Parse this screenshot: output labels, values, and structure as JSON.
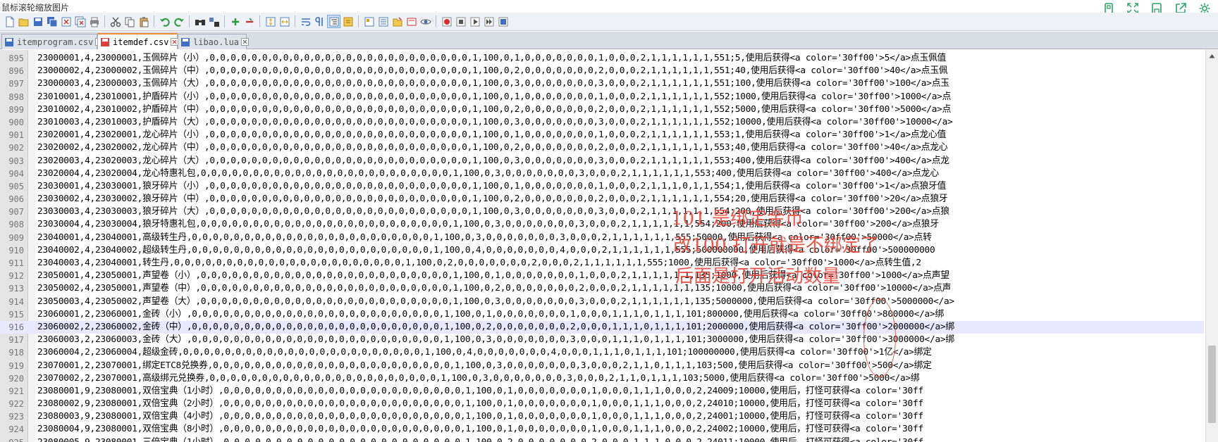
{
  "window": {
    "title": "鼠标滚轮缩放图片"
  },
  "tabs": [
    {
      "label": "itemprogram.csv",
      "active": false,
      "icon": "file-icon-blue"
    },
    {
      "label": "itemdef.csv",
      "active": true,
      "icon": "file-icon-red"
    },
    {
      "label": "libao.lua",
      "active": false,
      "icon": "file-icon-blue"
    }
  ],
  "editor": {
    "current_line": 916,
    "lines": [
      {
        "n": "895",
        "text": "23000001,4,23000001,玉佩碎片（小）,0,0,0,0,0,0,0,0,0,0,0,0,0,0,0,0,0,0,0,0,0,0,0,0,0,1,100,0,1,0,0,0,0,0,0,0,1,0,0,0,2,1,1,1,1,1,1,551;5,使用后获得<a color='30ff00'>5</a>点玉佩值"
      },
      {
        "n": "896",
        "text": "23000002,4,23000002,玉佩碎片（中）,0,0,0,0,0,0,0,0,0,0,0,0,0,0,0,0,0,0,0,0,0,0,0,0,0,1,100,0,2,0,0,0,0,0,0,0,2,0,0,0,2,1,1,1,1,1,1,551;40,使用后获得<a color='30ff00'>40</a>点玉佩"
      },
      {
        "n": "897",
        "text": "23000003,4,23000003,玉佩碎片（大）,0,0,0,0,0,0,0,0,0,0,0,0,0,0,0,0,0,0,0,0,0,0,0,0,0,1,100,0,3,0,0,0,0,0,0,0,3,0,0,0,2,1,1,1,1,1,1,551;100,使用后获得<a color='30ff00'>100</a>点玉"
      },
      {
        "n": "898",
        "text": "23010001,4,23010001,护盾碎片（小）,0,0,0,0,0,0,0,0,0,0,0,0,0,0,0,0,0,0,0,0,0,0,0,0,0,1,100,0,1,0,0,0,0,0,0,0,1,0,0,0,2,1,1,1,1,1,1,552;1000,使用后获得<a color='30ff00'>1000</a>点"
      },
      {
        "n": "899",
        "text": "23010002,4,23010002,护盾碎片（中）,0,0,0,0,0,0,0,0,0,0,0,0,0,0,0,0,0,0,0,0,0,0,0,0,0,1,100,0,2,0,0,0,0,0,0,0,2,0,0,0,2,1,1,1,1,1,1,552;5000,使用后获得<a color='30ff00'>5000</a>点"
      },
      {
        "n": "900",
        "text": "23010003,4,23010003,护盾碎片（大）,0,0,0,0,0,0,0,0,0,0,0,0,0,0,0,0,0,0,0,0,0,0,0,0,0,1,100,0,3,0,0,0,0,0,0,0,3,0,0,0,2,1,1,1,1,1,1,552;10000,使用后获得<a color='30ff00'>10000</a>"
      },
      {
        "n": "901",
        "text": "23020001,4,23020001,龙心碎片（小）,0,0,0,0,0,0,0,0,0,0,0,0,0,0,0,0,0,0,0,0,0,0,0,0,0,1,100,0,1,0,0,0,0,0,0,0,1,0,0,0,2,1,1,1,1,1,1,553;1,使用后获得<a color='30ff00'>1</a>点龙心值"
      },
      {
        "n": "902",
        "text": "23020002,4,23020002,龙心碎片（中）,0,0,0,0,0,0,0,0,0,0,0,0,0,0,0,0,0,0,0,0,0,0,0,0,0,1,100,0,2,0,0,0,0,0,0,0,2,0,0,0,2,1,1,1,1,1,1,553;40,使用后获得<a color='30ff00'>40</a>点龙心"
      },
      {
        "n": "903",
        "text": "23020003,4,23020003,龙心碎片（大）,0,0,0,0,0,0,0,0,0,0,0,0,0,0,0,0,0,0,0,0,0,0,0,0,0,1,100,0,3,0,0,0,0,0,0,0,3,0,0,0,2,1,1,1,1,1,1,553;400,使用后获得<a color='30ff00'>400</a>点龙"
      },
      {
        "n": "904",
        "text": "23020004,4,23020004,龙心特惠礼包,0,0,0,0,0,0,0,0,0,0,0,0,0,0,0,0,0,0,0,0,0,0,0,0,1,100,0,3,0,0,0,0,0,0,0,3,0,0,0,2,1,1,1,1,1,1,553;400,使用后获得<a color='30ff00'>400</a>点龙心"
      },
      {
        "n": "905",
        "text": "23030001,4,23030001,狼牙碎片（小）,0,0,0,0,0,0,0,0,0,0,0,0,0,0,0,0,0,0,0,0,0,0,0,0,0,1,100,0,1,0,0,0,0,0,0,0,1,0,0,0,2,1,1,1,0,1,1,554;1,使用后获得<a color='30ff00'>1</a>点狼牙值"
      },
      {
        "n": "906",
        "text": "23030002,4,23030002,狼牙碎片（中）,0,0,0,0,0,0,0,0,0,0,0,0,0,0,0,0,0,0,0,0,0,0,0,0,0,1,100,0,2,0,0,0,0,0,0,0,2,0,0,0,2,1,1,1,1,1,1,554;20,使用后获得<a color='30ff00'>20</a>点狼牙"
      },
      {
        "n": "907",
        "text": "23030003,4,23030003,狼牙碎片（大）,0,0,0,0,0,0,0,0,0,0,0,0,0,0,0,0,0,0,0,0,0,0,0,0,0,1,100,0,3,0,0,0,0,0,0,0,3,0,0,0,2,1,1,1,1,1,1,554;200,使用后获得<a color='30ff00'>200</a>点狼"
      },
      {
        "n": "908",
        "text": "23030004,4,23030004,狼牙特惠礼包,0,0,0,0,0,0,0,0,0,0,0,0,0,0,0,0,0,0,0,0,0,0,0,0,1,100,0,3,0,0,0,0,0,0,0,3,0,0,0,2,1,1,1,1,1,1,554;200,使用后获得<a color='30ff00'>200</a>点狼牙"
      },
      {
        "n": "909",
        "text": "23040001,4,23040001,高级转生丹,0,0,0,0,0,0,0,0,0,0,0,0,0,0,0,0,0,0,0,0,0,0,0,1,100,0,3,0,0,0,0,0,0,0,3,0,0,0,2,1,1,1,1,1,1,555;50000,使用后获得<a color='30ff00'>50000</a>点转"
      },
      {
        "n": "910",
        "text": "23040002,4,23040002,超级转生丹,0,0,0,0,0,0,0,0,0,0,0,0,0,0,0,0,0,0,0,0,0,0,0,1,100,0,4,0,0,0,0,0,0,0,4,0,0,0,2,1,1,1,1,1,1,555;500000000,使用后获得<a color='30ff00'>500000000"
      },
      {
        "n": "911",
        "text": "23040003,4,23040001,转生丹,0,0,0,0,0,0,0,0,0,0,0,0,0,0,0,0,0,0,0,0,0,0,1,100,0,2,0,0,0,0,0,0,0,2,0,0,0,2,1,1,1,1,1,1,555;1000,使用后获得<a color='30ff00'>1000</a>点转生值,2"
      },
      {
        "n": "912",
        "text": "23050001,4,23050001,声望卷（小）,0,0,0,0,0,0,0,0,0,0,0,0,0,0,0,0,0,0,0,0,0,0,0,0,1,100,0,1,0,0,0,0,0,0,0,1,0,0,0,2,1,1,1,1,1,1,135;1000,使用后获得<a color='30ff00'>1000</a>点声望"
      },
      {
        "n": "913",
        "text": "23050002,4,23050001,声望卷（中）,0,0,0,0,0,0,0,0,0,0,0,0,0,0,0,0,0,0,0,0,0,0,0,0,1,100,0,2,0,0,0,0,0,0,0,2,0,0,0,2,1,1,1,1,1,1,135;10000,使用后获得<a color='30ff00'>10000</a>点声"
      },
      {
        "n": "914",
        "text": "23050003,4,23050002,声望卷（大）,0,0,0,0,0,0,0,0,0,0,0,0,0,0,0,0,0,0,0,0,0,0,0,0,1,100,0,3,0,0,0,0,0,0,0,3,0,0,0,2,1,1,1,1,1,1,135;5000000,使用后获得<a color='30ff00'>5000000</a>"
      },
      {
        "n": "915",
        "text": "23060001,2,23060001,金砖（小）,0,0,0,0,0,0,0,0,0,0,0,0,0,0,0,0,0,0,0,0,0,0,0,0,1,100,0,1,0,0,0,0,0,0,0,1,0,0,0,1,1,1,0,1,1,1,101;800000,使用后获得<a color='30ff00'>800000</a>绑"
      },
      {
        "n": "916",
        "text": "23060002,2,23060002,金砖（中）,0,0,0,0,0,0,0,0,0,0,0,0,0,0,0,0,0,0,0,0,0,0,0,0,1,100,0,2,0,0,0,0,0,0,0,2,0,0,0,1,1,1,0,1,1,1,101;2000000,使用后获得<a color='30ff00'>2000000</a>绑"
      },
      {
        "n": "917",
        "text": "23060003,2,23060003,金砖（大）,0,0,0,0,0,0,0,0,0,0,0,0,0,0,0,0,0,0,0,0,0,0,0,0,1,100,0,3,0,0,0,0,0,0,0,3,0,0,0,1,1,1,0,1,1,1,101;3000000,使用后获得<a color='30ff00'>3000000</a>绑"
      },
      {
        "n": "918",
        "text": "23060004,2,23060004,超级金砖,0,0,0,0,0,0,0,0,0,0,0,0,0,0,0,0,0,0,0,0,0,0,0,1,100,0,4,0,0,0,0,0,0,0,4,0,0,0,1,1,1,0,1,1,1,101;100000000,使用后获得<a color='30ff00'>1亿</a>绑定"
      },
      {
        "n": "919",
        "text": "23070001,2,23070001,绑定ETC8兑换券,0,0,0,0,0,0,0,0,0,0,0,0,0,0,0,0,0,0,0,0,0,0,0,1,100,0,3,0,0,0,0,0,0,0,3,0,0,0,2,1,1,0,1,1,1,103;500,使用后获得<a color='30ff00'>500</a>绑定"
      },
      {
        "n": "920",
        "text": "23070002,2,23070001,高级绑元兑换券,0,0,0,0,0,0,0,0,0,0,0,0,0,0,0,0,0,0,0,0,0,0,1,100,0,3,0,0,0,0,0,0,0,3,0,0,0,2,1,1,0,1,1,1,103;5000,使用后获得<a color='30ff00'>5000</a>绑"
      },
      {
        "n": "921",
        "text": "23080001,9,23080001,双倍宝典（1小时）,0,0,0,0,0,0,0,0,0,0,0,0,0,0,0,0,0,0,0,0,0,0,0,1,100,0,1,0,0,0,0,0,0,0,1,0,0,0,1,1,1,0,0,0,2,24009;10000,使用后，打怪可获得<a color='30ff"
      },
      {
        "n": "922",
        "text": "23080002,9,23080001,双倍宝典（2小时）,0,0,0,0,0,0,0,0,0,0,0,0,0,0,0,0,0,0,0,0,0,0,0,1,100,0,1,0,0,0,0,0,0,0,1,0,0,0,1,1,1,0,0,0,2,24010;10000,使用后，打怪可获得<a color='30ff"
      },
      {
        "n": "923",
        "text": "23080003,9,23080001,双倍宝典（4小时）,0,0,0,0,0,0,0,0,0,0,0,0,0,0,0,0,0,0,0,0,0,0,0,1,100,0,1,0,0,0,0,0,0,0,1,0,0,0,1,1,1,0,0,0,2,24001;10000,使用后，打怪可获得<a color='30ff"
      },
      {
        "n": "924",
        "text": "23080004,9,23080001,双倍宝典（8小时）,0,0,0,0,0,0,0,0,0,0,0,0,0,0,0,0,0,0,0,0,0,0,0,1,100,0,1,0,0,0,0,0,0,0,1,0,0,0,1,1,1,0,0,0,2,24002;10000,使用后，打怪可获得<a color='30ff"
      },
      {
        "n": "925",
        "text": "23080005,9,23080001,三倍宝典（1小时）,0,0,0,0,0,0,0,0,0,0,0,0,0,0,0,0,0,0,0,0,0,0,0,1,100,0,2,0,0,0,0,0,0,0,2,0,0,0,1,1,1,0,0,0,2,24011;10000,使用后，打怪可获得<a color='30ff"
      }
    ]
  },
  "annotation": {
    "lines": [
      "101 是绑定金币",
      "改100 打开就是不绑定了",
      "后面是打开活动数量"
    ],
    "color": "#e8473a"
  },
  "colors": {
    "active_tab_accent": "#f08a3a",
    "current_line_bg": "#e8e8ff",
    "gutter_bg": "#e4e4e4"
  }
}
